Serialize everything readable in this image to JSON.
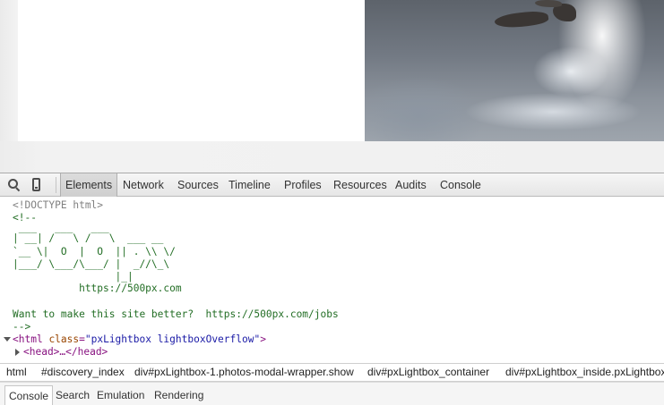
{
  "devtools": {
    "tabs": [
      {
        "label": "Elements",
        "active": true
      },
      {
        "label": "Network"
      },
      {
        "label": "Sources"
      },
      {
        "label": "Timeline"
      },
      {
        "label": "Profiles"
      },
      {
        "label": "Resources"
      },
      {
        "label": "Audits"
      },
      {
        "label": "Console"
      }
    ],
    "source": {
      "doctype": "<!DOCTYPE html>",
      "comment_open": "<!--",
      "ascii_art": [
        " ___   ___   ___",
        "| __| /   \\ /   \\  ___ __",
        "`__ \\|  O  |  O  || . \\\\ \\/",
        "|___/ \\___/\\___/ |  _//\\_\\",
        "                 |_|"
      ],
      "site_url": "           https://500px.com",
      "jobs_line": "Want to make this site better?  https://500px.com/jobs",
      "comment_close": "-->",
      "html_tag_open": "<html",
      "html_attr_name": "class",
      "html_attr_value": "\"pxLightbox lightboxOverflow\"",
      "html_tag_close": ">",
      "head_line": "<head>…</head>"
    },
    "breadcrumbs": [
      "html",
      "#discovery_index",
      "div#pxLightbox-1.photos-modal-wrapper.show",
      "div#pxLightbox_container",
      "div#pxLightbox_inside.pxLightbox"
    ],
    "drawer_tabs": [
      {
        "label": "Console",
        "active": true
      },
      {
        "label": "Search"
      },
      {
        "label": "Emulation"
      },
      {
        "label": "Rendering"
      }
    ]
  }
}
